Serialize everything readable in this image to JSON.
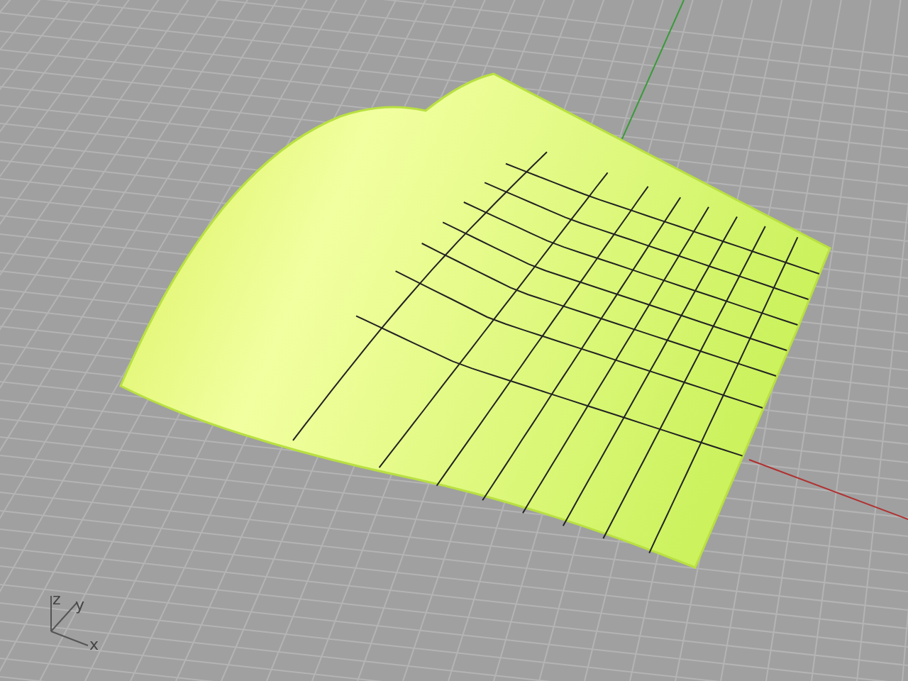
{
  "viewport": {
    "axis_gizmo": {
      "labels": [
        "z",
        "y",
        "x"
      ]
    }
  }
}
